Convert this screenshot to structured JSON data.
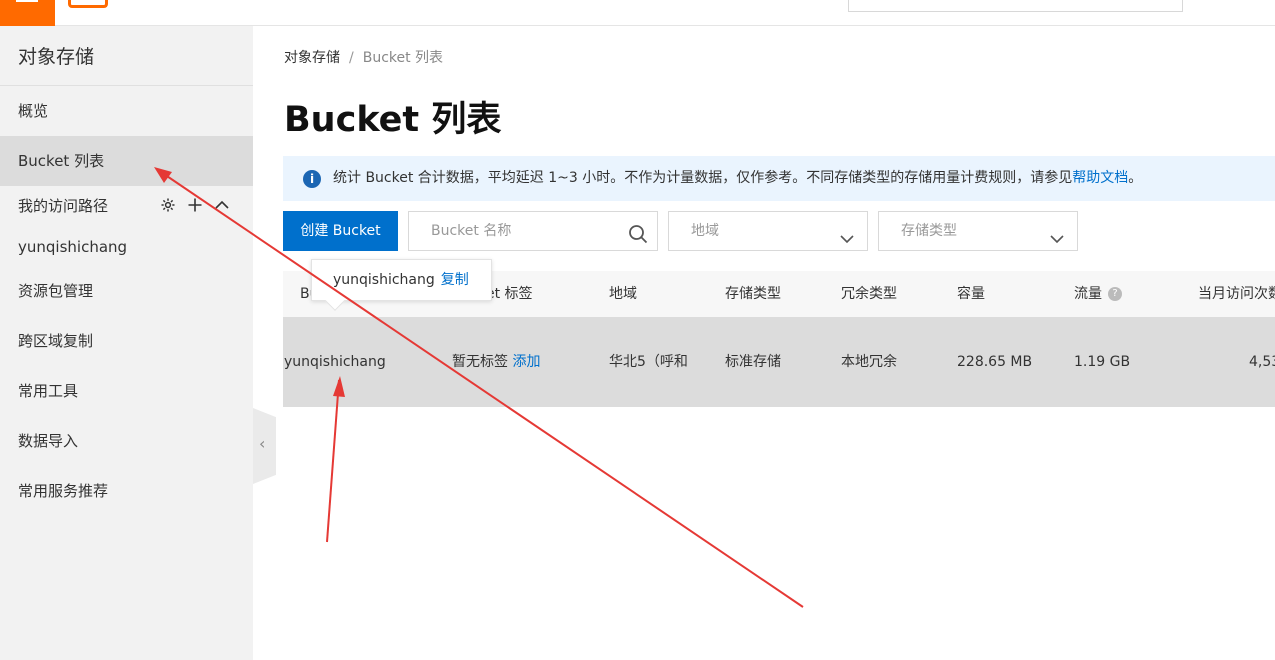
{
  "topbar": {
    "logo_text": "",
    "search_placeholder": "",
    "user_text": ""
  },
  "sidebar": {
    "title": "对象存储",
    "items": [
      {
        "label": "概览",
        "active": false
      },
      {
        "label": "Bucket 列表",
        "active": true
      },
      {
        "label": "yunqishichang",
        "active": false
      },
      {
        "label": "资源包管理",
        "active": false
      },
      {
        "label": "跨区域复制",
        "active": false
      },
      {
        "label": "常用工具",
        "active": false
      },
      {
        "label": "数据导入",
        "active": false
      },
      {
        "label": "常用服务推荐",
        "active": false
      }
    ],
    "group_label": "我的访问路径",
    "group_icons": [
      "gear-icon",
      "plus-icon",
      "chevron-up-icon"
    ],
    "collapse_icon": "chevron-left-icon"
  },
  "breadcrumb": {
    "root": "对象存储",
    "separator": "/",
    "current": "Bucket 列表"
  },
  "page_title": "Bucket 列表",
  "notice": {
    "icon": "info-icon",
    "text": "统计 Bucket 合计数据，平均延迟 1~3 小时。不作为计量数据，仅作参考。不同存储类型的存储用量计费规则，请参见",
    "link_text": "帮助文档",
    "suffix": "。"
  },
  "toolbar": {
    "create_label": "创建 Bucket",
    "search_placeholder": "Bucket 名称",
    "region_placeholder": "地域",
    "storage_class_placeholder": "存储类型"
  },
  "table": {
    "headers": [
      "Bu",
      "et 标签",
      "地域",
      "存储类型",
      "冗余类型",
      "容量",
      "流量",
      "当月访问次数"
    ],
    "row": {
      "name": "yunqishichang",
      "tag": "暂无标签",
      "tag_link": "添加",
      "region": "华北5（呼和",
      "storage_class": "标准存储",
      "redundancy": "本地冗余",
      "capacity": "228.65 MB",
      "traffic": "1.19 GB",
      "requests": "4,53"
    }
  },
  "tooltip": {
    "text": "yunqishichang",
    "link": "复制"
  },
  "colors": {
    "accent": "#0070cc",
    "brand": "#ff6a00",
    "annotation": "#e53935",
    "row_highlight": "#dcdcdc"
  }
}
